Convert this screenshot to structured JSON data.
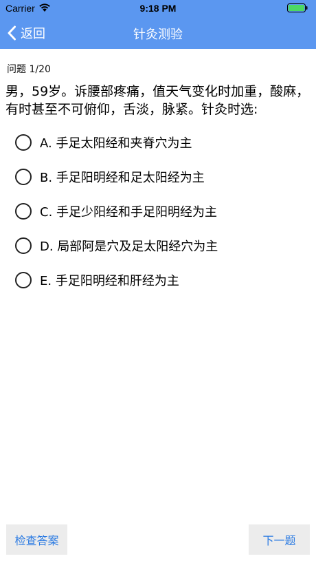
{
  "status_bar": {
    "carrier": "Carrier",
    "time": "9:18 PM"
  },
  "nav": {
    "back_label": "返回",
    "title": "针灸测验"
  },
  "question": {
    "counter": "问题 1/20",
    "text": "男，59岁。诉腰部疼痛，值天气变化时加重，酸麻，有时甚至不可俯仰，舌淡，脉紧。针灸时选:"
  },
  "options": [
    {
      "label": "A. 手足太阳经和夹脊穴为主"
    },
    {
      "label": "B. 手足阳明经和足太阳经为主"
    },
    {
      "label": "C. 手足少阳经和手足阳明经为主"
    },
    {
      "label": "D. 局部阿是穴及足太阳经穴为主"
    },
    {
      "label": "E. 手足阳明经和肝经为主"
    }
  ],
  "buttons": {
    "check_answer": "检查答案",
    "next": "下一题"
  },
  "colors": {
    "nav_background": "#5b97f0",
    "button_text": "#2a7ae2",
    "battery_fill": "#4cd964"
  }
}
